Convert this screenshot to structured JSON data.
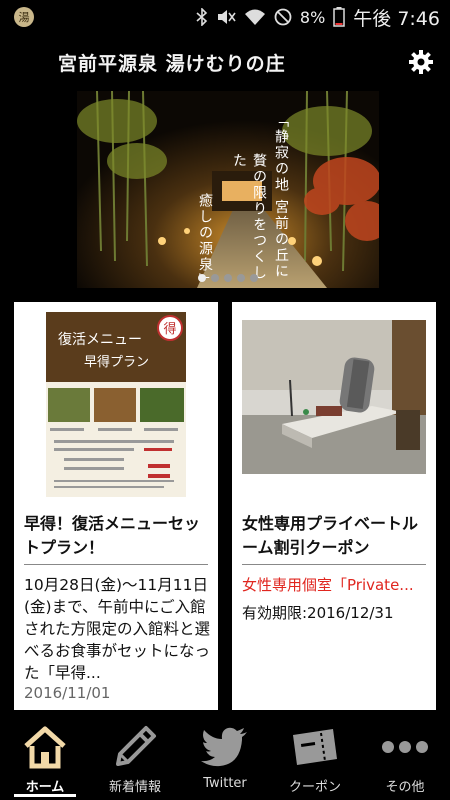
{
  "status_bar": {
    "battery": "8%",
    "time": "午後 7:46",
    "icons": [
      "notification-logo-icon",
      "bluetooth-icon",
      "mute-icon",
      "wifi-icon",
      "dnd-icon",
      "battery-icon"
    ]
  },
  "header": {
    "title": "宮前平源泉 湯けむりの庄",
    "settings_icon": "gear-icon"
  },
  "banner": {
    "text_lines": [
      "「静寂の地 宮前の丘に",
      "贅の限りをつくした",
      "癒しの源泉」"
    ],
    "slides": 5,
    "active_slide": 1
  },
  "poster": {
    "heading": "復活メニュー",
    "subheading": "早得プラン",
    "badge": "得"
  },
  "cards": [
    {
      "title": "早得！復活メニューセットプラン！",
      "body": "10月28日(金)〜11月11日(金)まで、午前中にご入館された方限定の入館料と選べるお食事がセットになった「早得...",
      "date": "2016/11/01"
    },
    {
      "title": "女性専用プライベートルーム割引クーポン",
      "subtitle": "女性専用個室「Private...",
      "expiry": "有効期限:2016/12/31"
    }
  ],
  "tabs": [
    {
      "label": "ホーム",
      "icon": "home-icon",
      "active": true
    },
    {
      "label": "新着情報",
      "icon": "pencil-icon",
      "active": false
    },
    {
      "label": "Twitter",
      "icon": "twitter-bird-icon",
      "active": false
    },
    {
      "label": "クーポン",
      "icon": "coupon-ticket-icon",
      "active": false
    },
    {
      "label": "その他",
      "icon": "more-dots-icon",
      "active": false
    }
  ],
  "colors": {
    "accent_red": "#e0261f",
    "background": "#000000"
  }
}
